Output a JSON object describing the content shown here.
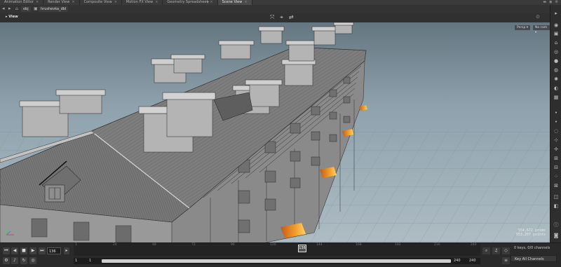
{
  "tabs": [
    {
      "label": "Animation Editor",
      "active": false
    },
    {
      "label": "Render View",
      "active": false
    },
    {
      "label": "Composite View",
      "active": false
    },
    {
      "label": "Motion FX View",
      "active": false
    },
    {
      "label": "Geometry Spreadsheet",
      "active": false
    },
    {
      "label": "Scene View",
      "active": true
    }
  ],
  "path": {
    "root": "obj",
    "node": "hrushevka_dbl"
  },
  "viewport": {
    "label": "View",
    "perspective": "Persp ▾",
    "camera": "No cam ▾",
    "stats": [
      "554,672  prims",
      "553,207  points"
    ]
  },
  "timeline": {
    "current_frame": "136",
    "ruler_ticks": [
      "1",
      "24",
      "48",
      "72",
      "96",
      "120",
      "144",
      "168",
      "192",
      "216",
      "240"
    ],
    "ruler_current": "136",
    "range_start_a": "1",
    "range_start_b": "1",
    "range_end_a": "240",
    "range_end_b": "240",
    "keys_info": "0 keys, 0/0 channels",
    "key_all": "Key All Channels"
  },
  "colors": {
    "accent_orange": "#e8881e",
    "sky_top": "#647680",
    "sky_bottom": "#aebcc3"
  }
}
